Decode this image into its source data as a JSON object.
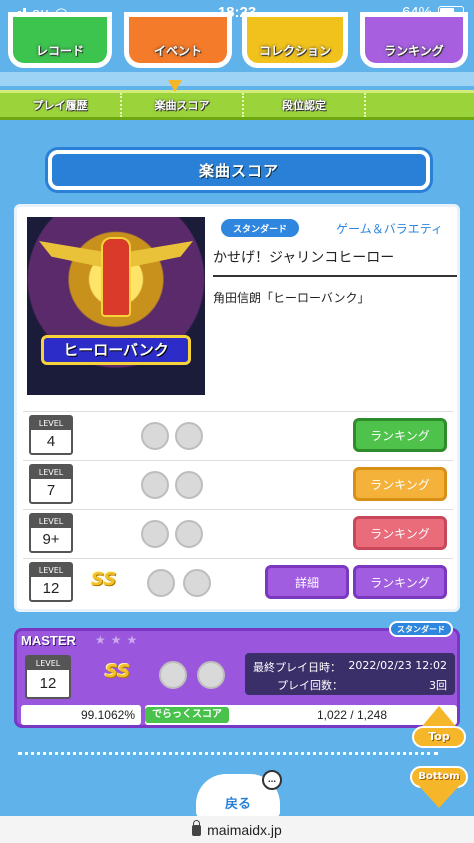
{
  "status": {
    "carrier": "au",
    "time": "18:23",
    "battery": "64%"
  },
  "topnav": [
    {
      "label": "レコード"
    },
    {
      "label": "イベント"
    },
    {
      "label": "コレクション"
    },
    {
      "label": "ランキング"
    }
  ],
  "subtabs": [
    {
      "label": "プレイ履歴"
    },
    {
      "label": "楽曲スコア"
    },
    {
      "label": "段位認定"
    },
    {
      "label": ""
    }
  ],
  "heading": "楽曲スコア",
  "song": {
    "badge": "スタンダード",
    "genre": "ゲーム＆バラエティ",
    "title": "かせげ！ジャリンコヒーロー",
    "artist": "角田信朗「ヒーローバンク」",
    "jacket_text": "ヒーローバンク"
  },
  "levels": [
    {
      "label": "LEVEL",
      "value": "4",
      "rank_button": "ランキング",
      "color": "#4fc24b"
    },
    {
      "label": "LEVEL",
      "value": "7",
      "rank_button": "ランキング",
      "color": "#f4b23a"
    },
    {
      "label": "LEVEL",
      "value": "9+",
      "rank_button": "ランキング",
      "color": "#ea6b7a"
    },
    {
      "label": "LEVEL",
      "value": "12",
      "rank_button": "ランキング",
      "detail_button": "詳細",
      "rank_mark": "SS",
      "color": "#a15de0"
    }
  ],
  "master": {
    "label": "MASTER",
    "badge": "スタンダード",
    "level_label": "LEVEL",
    "level": "12",
    "rank_mark": "SS",
    "last_play_label": "最終プレイ日時：",
    "last_play": "2022/02/23 12:02",
    "play_count_label": "プレイ回数：",
    "play_count": "3回",
    "achievement": "99.1062%",
    "dx_score_label": "でらっくスコア",
    "dx_score": "1,022 / 1,248"
  },
  "buttons": {
    "top": "Top",
    "bottom": "Bottom",
    "back": "戻る"
  },
  "url": "maimaidx.jp"
}
